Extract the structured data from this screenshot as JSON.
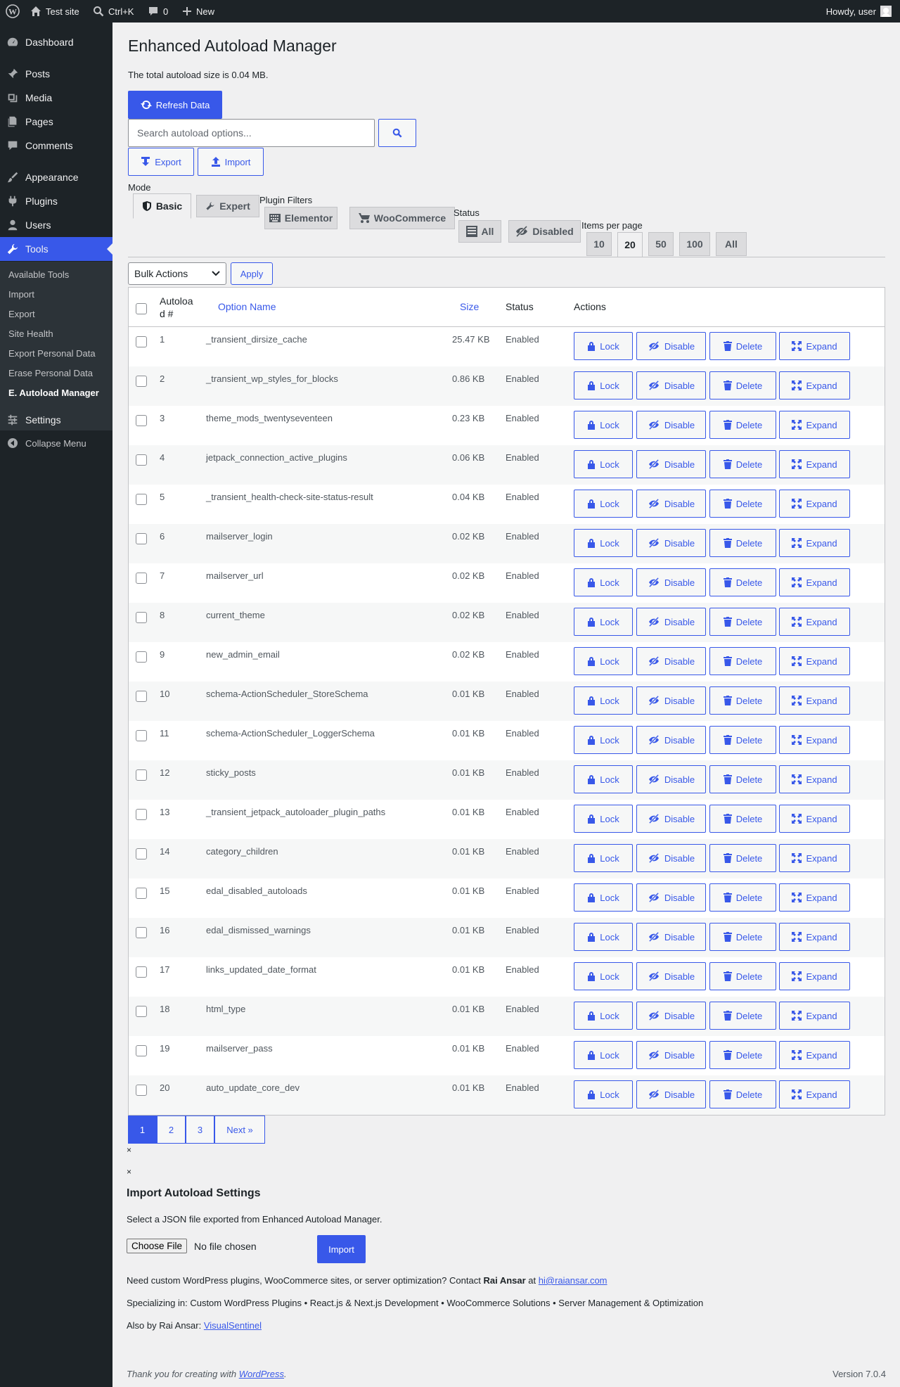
{
  "adminbar": {
    "site_name": "Test site",
    "shortcut": "Ctrl+K",
    "comments_count": "0",
    "new_label": "New",
    "howdy": "Howdy, user"
  },
  "sidebar": {
    "items": [
      {
        "label": "Dashboard",
        "icon": "dashboard-icon"
      },
      {
        "label": "Posts",
        "icon": "pin-icon"
      },
      {
        "label": "Media",
        "icon": "media-icon"
      },
      {
        "label": "Pages",
        "icon": "pages-icon"
      },
      {
        "label": "Comments",
        "icon": "comment-icon"
      },
      {
        "label": "Appearance",
        "icon": "brush-icon"
      },
      {
        "label": "Plugins",
        "icon": "plug-icon"
      },
      {
        "label": "Users",
        "icon": "user-icon"
      },
      {
        "label": "Tools",
        "icon": "wrench-icon"
      },
      {
        "label": "Settings",
        "icon": "sliders-icon"
      }
    ],
    "submenu": [
      "Available Tools",
      "Import",
      "Export",
      "Site Health",
      "Export Personal Data",
      "Erase Personal Data",
      "E. Autoload Manager"
    ],
    "collapse": "Collapse Menu",
    "accent_color": "#3858e9"
  },
  "page": {
    "title": "Enhanced Autoload Manager",
    "size_text": "The total autoload size is 0.04 MB.",
    "refresh_label": "Refresh Data",
    "search_placeholder": "Search autoload options...",
    "export_label": "Export",
    "import_label": "Import",
    "mode_label": "Mode",
    "mode_tabs": [
      "Basic",
      "Expert"
    ],
    "plugin_filters_label": "Plugin Filters",
    "plugin_tabs": [
      "Elementor",
      "WooCommerce"
    ],
    "status_label": "Status",
    "status_tabs": [
      "All",
      "Disabled"
    ],
    "per_page_label": "Items per page",
    "per_page_tabs": [
      "10",
      "20",
      "50",
      "100",
      "All"
    ],
    "bulk_actions": "Bulk Actions",
    "apply_label": "Apply"
  },
  "table": {
    "headers": {
      "num": [
        "Autoloa",
        "d #"
      ],
      "name": "Option Name",
      "size": "Size",
      "status": "Status",
      "actions": "Actions"
    },
    "action_labels": [
      "Lock",
      "Disable",
      "Delete",
      "Expand"
    ],
    "rows": [
      {
        "num": "1",
        "name": "_transient_dirsize_cache",
        "size": "25.47 KB",
        "status": "Enabled"
      },
      {
        "num": "2",
        "name": "_transient_wp_styles_for_blocks",
        "size": "0.86 KB",
        "status": "Enabled"
      },
      {
        "num": "3",
        "name": "theme_mods_twentyseventeen",
        "size": "0.23 KB",
        "status": "Enabled"
      },
      {
        "num": "4",
        "name": "jetpack_connection_active_plugins",
        "size": "0.06 KB",
        "status": "Enabled"
      },
      {
        "num": "5",
        "name": "_transient_health-check-site-status-result",
        "size": "0.04 KB",
        "status": "Enabled"
      },
      {
        "num": "6",
        "name": "mailserver_login",
        "size": "0.02 KB",
        "status": "Enabled"
      },
      {
        "num": "7",
        "name": "mailserver_url",
        "size": "0.02 KB",
        "status": "Enabled"
      },
      {
        "num": "8",
        "name": "current_theme",
        "size": "0.02 KB",
        "status": "Enabled"
      },
      {
        "num": "9",
        "name": "new_admin_email",
        "size": "0.02 KB",
        "status": "Enabled"
      },
      {
        "num": "10",
        "name": "schema-ActionScheduler_StoreSchema",
        "size": "0.01 KB",
        "status": "Enabled"
      },
      {
        "num": "11",
        "name": "schema-ActionScheduler_LoggerSchema",
        "size": "0.01 KB",
        "status": "Enabled"
      },
      {
        "num": "12",
        "name": "sticky_posts",
        "size": "0.01 KB",
        "status": "Enabled"
      },
      {
        "num": "13",
        "name": "_transient_jetpack_autoloader_plugin_paths",
        "size": "0.01 KB",
        "status": "Enabled"
      },
      {
        "num": "14",
        "name": "category_children",
        "size": "0.01 KB",
        "status": "Enabled"
      },
      {
        "num": "15",
        "name": "edal_disabled_autoloads",
        "size": "0.01 KB",
        "status": "Enabled"
      },
      {
        "num": "16",
        "name": "edal_dismissed_warnings",
        "size": "0.01 KB",
        "status": "Enabled"
      },
      {
        "num": "17",
        "name": "links_updated_date_format",
        "size": "0.01 KB",
        "status": "Enabled"
      },
      {
        "num": "18",
        "name": "html_type",
        "size": "0.01 KB",
        "status": "Enabled"
      },
      {
        "num": "19",
        "name": "mailserver_pass",
        "size": "0.01 KB",
        "status": "Enabled"
      },
      {
        "num": "20",
        "name": "auto_update_core_dev",
        "size": "0.01 KB",
        "status": "Enabled"
      }
    ]
  },
  "pagination": [
    "1",
    "2",
    "3",
    "Next »"
  ],
  "close_marks": [
    "×",
    "×"
  ],
  "import_section": {
    "title": "Import Autoload Settings",
    "desc": "Select a JSON file exported from Enhanced Autoload Manager.",
    "choose_file": "Choose File",
    "no_file": "No file chosen",
    "import_button": "Import"
  },
  "footer": {
    "line1_prefix": "Need custom WordPress plugins, WooCommerce sites, or server optimization? Contact",
    "line1_name": "Rai Ansar",
    "line1_at": "at",
    "line1_email": "hi@raiansar.com",
    "line2": "Specializing in: Custom WordPress Plugins • React.js & Next.js Development • WooCommerce Solutions • Server Management & Optimization",
    "line3_prefix": "Also by Rai Ansar:",
    "line3_link": "VisualSentinel",
    "thanks_prefix": "Thank you for creating with",
    "thanks_link": "WordPress",
    "thanks_suffix": ".",
    "version": "Version 7.0.4"
  }
}
